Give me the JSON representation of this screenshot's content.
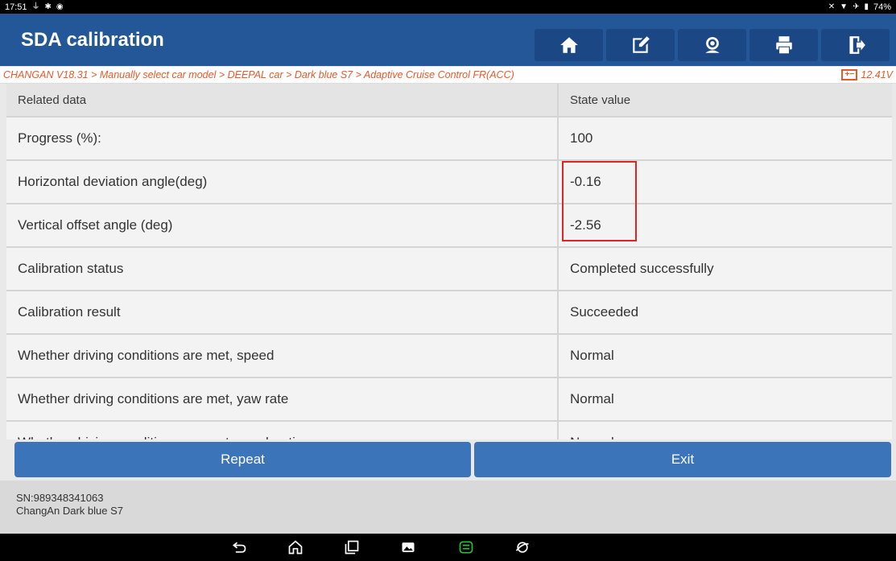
{
  "status_bar": {
    "time": "17:51",
    "battery": "74%"
  },
  "app": {
    "title": "SDA calibration",
    "toolbar": [
      "home-icon",
      "edit-icon",
      "user-support-icon",
      "print-icon",
      "exit-icon"
    ]
  },
  "breadcrumb": {
    "path": "CHANGAN V18.31 > Manually select car model > DEEPAL car > Dark blue S7 > Adaptive Cruise Control FR(ACC)",
    "voltage": "12.41V"
  },
  "table": {
    "headers": {
      "name": "Related data",
      "value": "State value"
    },
    "rows": [
      {
        "name": "Progress (%):",
        "value": "100"
      },
      {
        "name": "Horizontal deviation angle(deg)",
        "value": "-0.16"
      },
      {
        "name": "Vertical offset angle (deg)",
        "value": "-2.56"
      },
      {
        "name": "Calibration status",
        "value": "Completed successfully"
      },
      {
        "name": "Calibration result",
        "value": "Succeeded"
      },
      {
        "name": "Whether driving conditions are met, speed",
        "value": "Normal"
      },
      {
        "name": "Whether driving conditions are met, yaw rate",
        "value": "Normal"
      },
      {
        "name": "Whether driving conditions are met, acceleration",
        "value": "Normal"
      }
    ]
  },
  "actions": {
    "repeat": "Repeat",
    "exit": "Exit"
  },
  "footer": {
    "sn": "SN:989348341063",
    "vehicle": "ChangAn Dark blue S7"
  },
  "colors": {
    "title_bar": "#235798",
    "button": "#3b74b8",
    "breadcrumb_text": "#e55a2b",
    "highlight": "#e02424"
  }
}
